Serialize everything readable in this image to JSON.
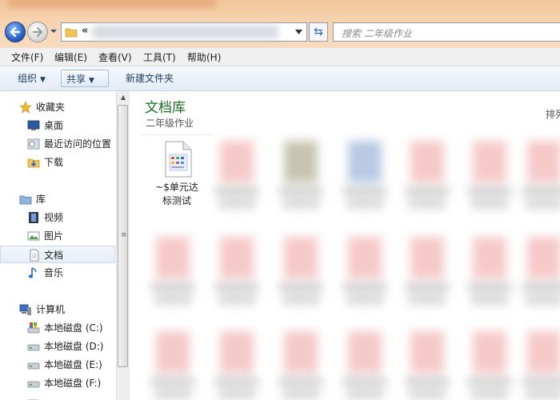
{
  "address_bar": {
    "chevron": "«",
    "search_placeholder": "搜索 二年级作业"
  },
  "menu": {
    "items": [
      "文件(F)",
      "编辑(E)",
      "查看(V)",
      "工具(T)",
      "帮助(H)"
    ]
  },
  "toolbar": {
    "organize": "组织",
    "share": "共享",
    "new_folder": "新建文件夹"
  },
  "nav": {
    "favorites": {
      "label": "收藏夹",
      "items": [
        "桌面",
        "最近访问的位置",
        "下载"
      ]
    },
    "libraries": {
      "label": "库",
      "items": [
        "视频",
        "图片",
        "文档",
        "音乐"
      ],
      "selected": "文档"
    },
    "computer": {
      "label": "计算机",
      "drives": [
        "本地磁盘 (C:)",
        "本地磁盘 (D:)",
        "本地磁盘 (E:)",
        "本地磁盘 (F:)"
      ]
    }
  },
  "content": {
    "library_title": "文档库",
    "library_subtitle": "二年级作业",
    "sort_label": "排列",
    "files": [
      {
        "name_line1": "~$单元达",
        "name_line2": "标测试",
        "icon": "word-temp-file-icon"
      }
    ]
  },
  "colors": {
    "title_bar": "#f6d2ad",
    "library_title": "#1a6f25",
    "selection": "#e5edf6"
  }
}
